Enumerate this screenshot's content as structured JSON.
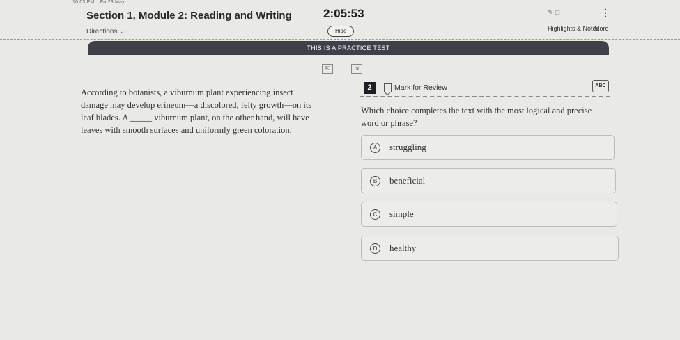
{
  "status_bar": {
    "time": "10:03 PM",
    "date": "Fri 23 May"
  },
  "header": {
    "section_title": "Section 1, Module 2: Reading and Writing",
    "directions_label": "Directions",
    "timer": "2:05:53",
    "hide_label": "Hide",
    "highlights_label": "Highlights & Notes",
    "more_label": "More"
  },
  "banner": {
    "text": "THIS IS A PRACTICE TEST"
  },
  "passage": {
    "text": "According to botanists, a viburnum plant experiencing insect damage may develop erineum—a discolored, felty growth—on its leaf blades. A _____ viburnum plant, on the other hand, will have leaves with smooth surfaces and uniformly green coloration."
  },
  "question": {
    "number": "2",
    "mark_review_label": "Mark for Review",
    "abc_label": "ABC",
    "prompt": "Which choice completes the text with the most logical and precise word or phrase?",
    "choices": [
      {
        "letter": "A",
        "text": "struggling"
      },
      {
        "letter": "B",
        "text": "beneficial"
      },
      {
        "letter": "C",
        "text": "simple"
      },
      {
        "letter": "D",
        "text": "healthy"
      }
    ]
  },
  "icons": {
    "bookmark": "bookmark-icon",
    "expand_left": "expand-icon",
    "expand_right": "collapse-icon",
    "kebab": "kebab-icon",
    "tools": "pencil-icon"
  },
  "colors": {
    "banner_bg": "#3d4149",
    "question_number_bg": "#1d1f26",
    "page_bg": "#e9e9e6"
  }
}
